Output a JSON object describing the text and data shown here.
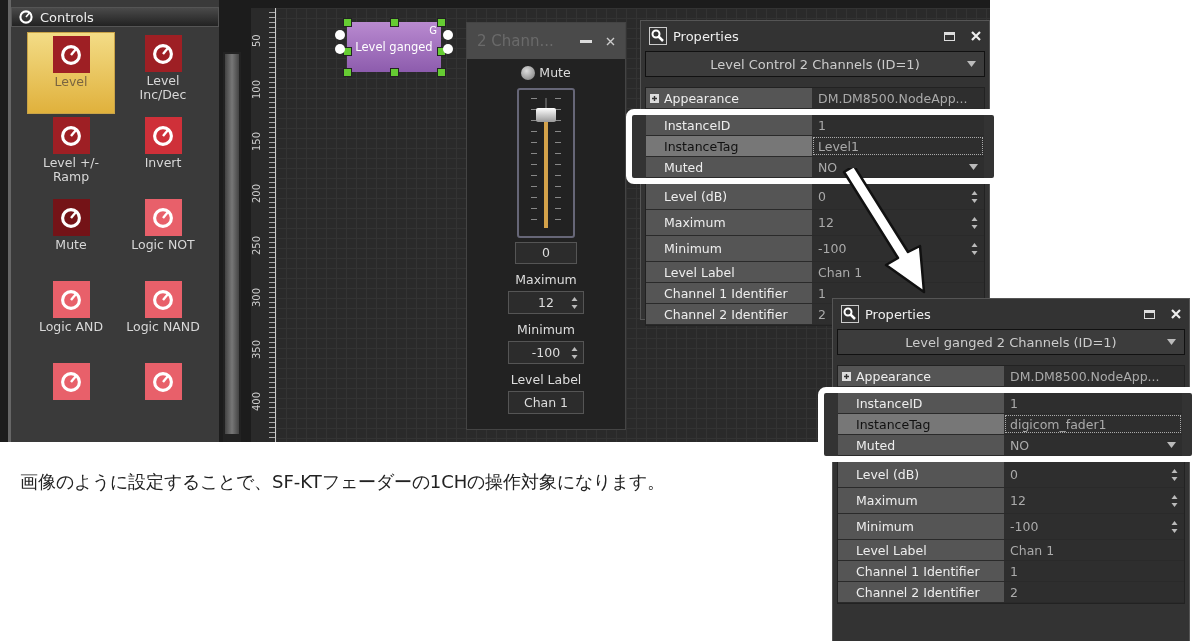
{
  "controls_panel": {
    "title": "Controls",
    "items": [
      {
        "label": "Level",
        "selected": true,
        "color": "#9e1f24"
      },
      {
        "label": "Level\nInc/Dec",
        "selected": false,
        "color": "#9e1f24"
      },
      {
        "label": "Level +/-\nRamp",
        "selected": false,
        "color": "#9e1f24"
      },
      {
        "label": "Invert",
        "selected": false,
        "color": "#cf3039"
      },
      {
        "label": "Mute",
        "selected": false,
        "color": "#741317"
      },
      {
        "label": "Logic NOT",
        "selected": false,
        "color": "#e8606a"
      },
      {
        "label": "Logic AND",
        "selected": false,
        "color": "#e8606a"
      },
      {
        "label": "Logic NAND",
        "selected": false,
        "color": "#e8606a"
      },
      {
        "selected": false,
        "color": "#e8606a"
      },
      {
        "selected": false,
        "color": "#e8606a"
      }
    ]
  },
  "ruler": {
    "labels": [
      "50",
      "100",
      "150",
      "200",
      "250",
      "300",
      "350",
      "400"
    ]
  },
  "canvas": {
    "node": {
      "label": "Level ganged",
      "badge": "G",
      "selected": true
    }
  },
  "channel_window": {
    "title": "2 Chann...",
    "mute": {
      "label": "Mute",
      "on": false
    },
    "fader": {
      "level": 0.88
    },
    "value": "0",
    "fields": [
      {
        "label": "Maximum",
        "value": "12",
        "kind": "spin"
      },
      {
        "label": "Minimum",
        "value": "-100",
        "kind": "spin"
      },
      {
        "label": "Level Label",
        "value": "Chan 1",
        "kind": "text"
      }
    ]
  },
  "properties_panels": [
    {
      "title": "Properties",
      "object": "Level Control 2 Channels (ID=1)",
      "rows": [
        {
          "name": "Appearance",
          "value": "DM.DM8500.NodeApp...",
          "kind": "group",
          "selected": false
        },
        {
          "name": "InstanceID",
          "value": "1",
          "kind": "text",
          "selected": false
        },
        {
          "name": "InstanceTag",
          "value": "Level1",
          "kind": "text",
          "selected": true
        },
        {
          "name": "Muted",
          "value": "NO",
          "kind": "dropdown",
          "selected": false
        },
        {
          "name": "Level (dB)",
          "value": "0",
          "kind": "spin",
          "selected": false
        },
        {
          "name": "Maximum",
          "value": "12",
          "kind": "spin",
          "selected": false
        },
        {
          "name": "Minimum",
          "value": "-100",
          "kind": "spin",
          "selected": false
        },
        {
          "name": "Level Label",
          "value": "Chan 1",
          "kind": "text",
          "selected": false
        },
        {
          "name": "Channel 1 Identifier",
          "value": "1",
          "kind": "text",
          "selected": false
        },
        {
          "name": "Channel 2 Identifier",
          "value": "2",
          "kind": "text",
          "selected": false
        }
      ]
    },
    {
      "title": "Properties",
      "object": "Level ganged 2 Channels (ID=1)",
      "rows": [
        {
          "name": "Appearance",
          "value": "DM.DM8500.NodeApp...",
          "kind": "group",
          "selected": false
        },
        {
          "name": "InstanceID",
          "value": "1",
          "kind": "text",
          "selected": false
        },
        {
          "name": "InstanceTag",
          "value": "digicom_fader1",
          "kind": "text",
          "selected": true
        },
        {
          "name": "Muted",
          "value": "NO",
          "kind": "dropdown",
          "selected": false
        },
        {
          "name": "Level (dB)",
          "value": "0",
          "kind": "spin",
          "selected": false
        },
        {
          "name": "Maximum",
          "value": "12",
          "kind": "spin",
          "selected": false
        },
        {
          "name": "Minimum",
          "value": "-100",
          "kind": "spin",
          "selected": false
        },
        {
          "name": "Level Label",
          "value": "Chan 1",
          "kind": "text",
          "selected": false
        },
        {
          "name": "Channel 1 Identifier",
          "value": "1",
          "kind": "text",
          "selected": false
        },
        {
          "name": "Channel 2 Identifier",
          "value": "2",
          "kind": "text",
          "selected": false
        }
      ]
    }
  ],
  "caption": "画像のように設定することで、SF-KTフェーダーの1CHの操作対象になります。"
}
